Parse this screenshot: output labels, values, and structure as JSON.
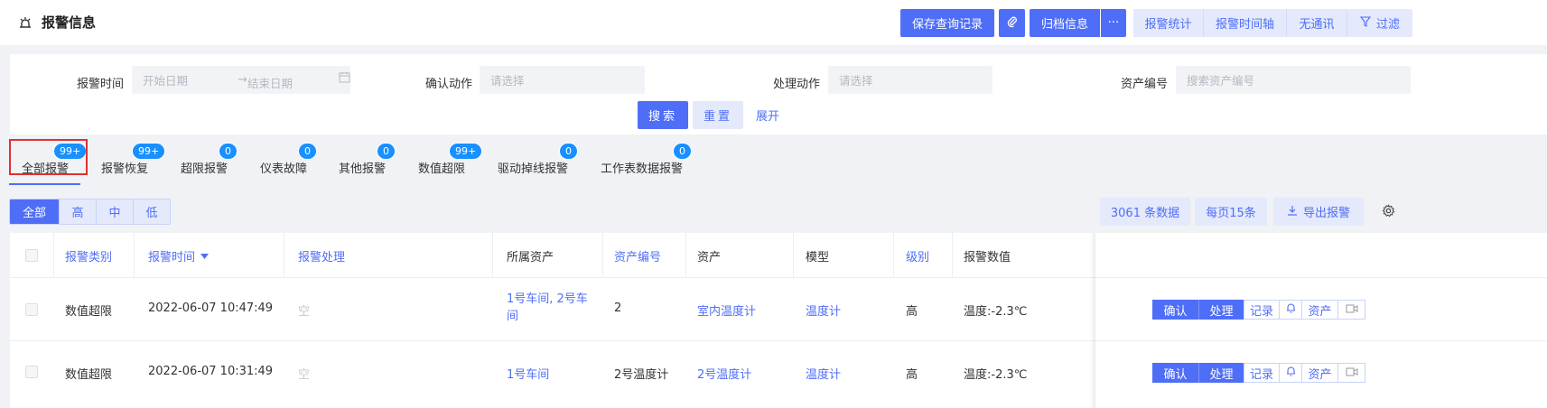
{
  "header": {
    "title": "报警信息",
    "icon": "alarm-icon",
    "buttons": {
      "save_query": "保存查询记录",
      "attach_icon": "paperclip-icon",
      "archive": "归档信息",
      "more": "···",
      "stats": "报警统计",
      "timeline": "报警时间轴",
      "no_comm": "无通讯",
      "filter": "过滤",
      "filter_icon": "funnel-icon"
    }
  },
  "filters": {
    "alarm_time_label": "报警时间",
    "start_placeholder": "开始日期",
    "end_placeholder": "结束日期",
    "confirm_action_label": "确认动作",
    "confirm_action_placeholder": "请选择",
    "handle_action_label": "处理动作",
    "handle_action_placeholder": "请选择",
    "asset_no_label": "资产编号",
    "asset_no_placeholder": "搜索资产编号",
    "search": "搜索",
    "reset": "重置",
    "expand": "展开"
  },
  "tabs": [
    {
      "label": "全部报警",
      "badge": "99+"
    },
    {
      "label": "报警恢复",
      "badge": "99+"
    },
    {
      "label": "超限报警",
      "badge": "0"
    },
    {
      "label": "仪表故障",
      "badge": "0"
    },
    {
      "label": "其他报警",
      "badge": "0"
    },
    {
      "label": "数值超限",
      "badge": "99+"
    },
    {
      "label": "驱动掉线报警",
      "badge": "0"
    },
    {
      "label": "工作表数据报警",
      "badge": "0"
    }
  ],
  "levels": [
    "全部",
    "高",
    "中",
    "低"
  ],
  "toolbar": {
    "count": "3061 条数据",
    "per_page": "每页15条",
    "export": "导出报警",
    "export_icon": "download-icon",
    "settings_icon": "gear-icon"
  },
  "table": {
    "columns": [
      "报警类别",
      "报警时间",
      "报警处理",
      "所属资产",
      "资产编号",
      "资产",
      "模型",
      "级别",
      "报警数值"
    ],
    "rows": [
      {
        "category": "数值超限",
        "time": "2022-06-07 10:47:49",
        "handling": "空",
        "owner_asset": "1号车间, 2号车间",
        "asset_no": "2",
        "asset": "室内温度计",
        "model": "温度计",
        "level": "高",
        "value": "温度:-2.3℃"
      },
      {
        "category": "数值超限",
        "time": "2022-06-07 10:31:49",
        "handling": "空",
        "owner_asset": "1号车间",
        "asset_no": "2号温度计",
        "asset": "2号温度计",
        "model": "温度计",
        "level": "高",
        "value": "温度:-2.3℃"
      }
    ],
    "ops": {
      "confirm": "确认",
      "handle": "处理",
      "record": "记录",
      "bell_icon": "bell-icon",
      "asset": "资产",
      "video_icon": "video-icon"
    }
  },
  "colors": {
    "primary": "#4f6ef7",
    "light": "#e4e9fb",
    "badge": "#1890ff",
    "highlight": "#e03131"
  }
}
